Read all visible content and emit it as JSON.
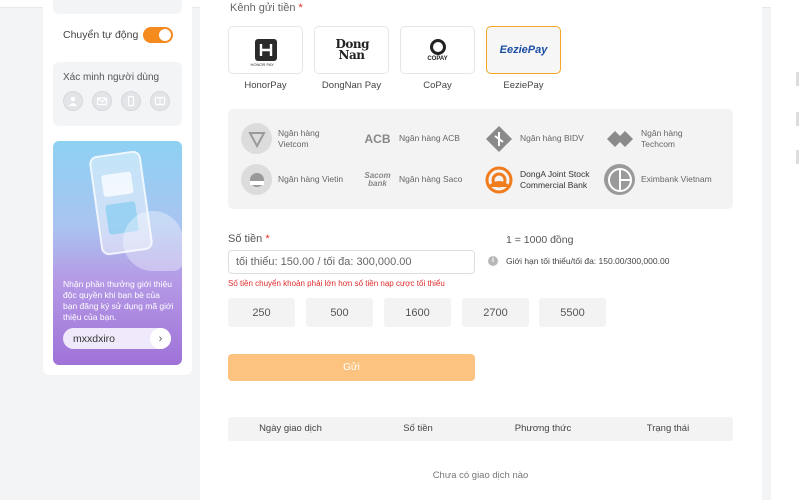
{
  "sidebar": {
    "auto_label": "Chuyển tự động",
    "verify_title": "Xác minh người dùng",
    "verify_icons": [
      "user-icon",
      "mail-icon",
      "phone-icon",
      "card-icon"
    ],
    "promo_text": "Nhận phần thưởng giới thiệu độc quyền khi bạn bè của bạn đăng ký sử dụng mã giới thiệu của bạn.",
    "promo_code": "mxxdxiro"
  },
  "main": {
    "channel_title": "Kênh gửi tiền",
    "channels": [
      {
        "label": "HonorPay"
      },
      {
        "label": "DongNan Pay",
        "logo_text": "Dong Nan"
      },
      {
        "label": "CoPay",
        "logo_text": "COPAY"
      },
      {
        "label": "EeziePay",
        "logo_text": "EeziePay"
      }
    ],
    "banks": [
      {
        "label": "Ngân hàng Vietcom"
      },
      {
        "label": "Ngân hàng ACB",
        "logo_text": "ACB"
      },
      {
        "label": "Ngân hàng BIDV"
      },
      {
        "label": "Ngân hàng Techcom"
      },
      {
        "label": "Ngân hàng Vietin"
      },
      {
        "label": "Ngân hàng Saco",
        "logo_text": "Sacom bank"
      },
      {
        "label": "DongA Joint Stock Commercial Bank"
      },
      {
        "label": "Eximbank Vietnam"
      }
    ],
    "amount_label": "Số tiền",
    "rate_text": "1 = 1000 đồng",
    "amount_placeholder": "tối thiểu: 150.00 / tối đa: 300,000.00",
    "limit_text": "Giới hạn tối thiểu/tối đa: 150.00/300,000.00",
    "error_text": "Số tiền chuyển khoản phải lớn hơn số tiền nạp cược tối thiểu",
    "quick_amounts": [
      "250",
      "500",
      "1600",
      "2700",
      "5500"
    ],
    "submit_label": "Gửi",
    "table_headers": [
      "Ngày giao dịch",
      "Số tiền",
      "Phương thức",
      "Trạng thái"
    ],
    "empty_text": "Chưa có giao dịch nào"
  },
  "colors": {
    "accent": "#f58a1f",
    "submit_bg": "#fbc37f",
    "active_border": "#f5a623",
    "error": "#e02b2b"
  }
}
